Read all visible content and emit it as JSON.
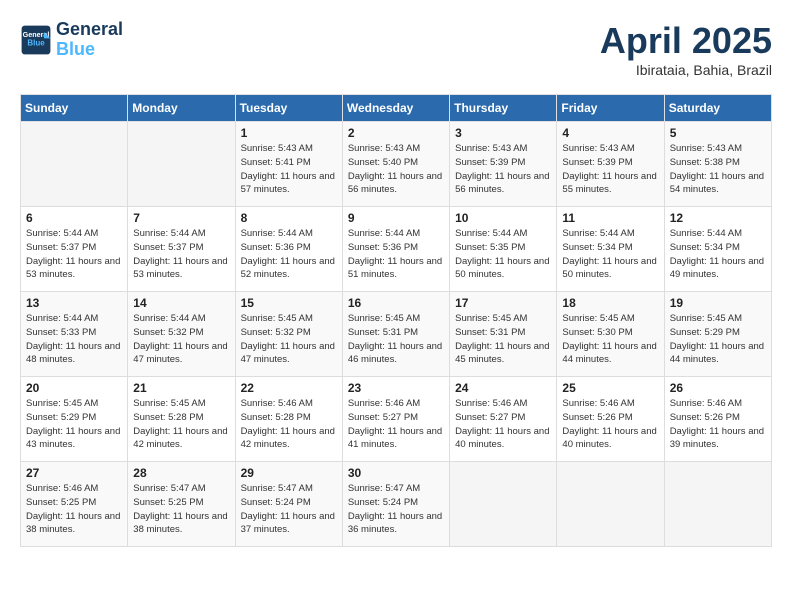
{
  "header": {
    "logo_line1": "General",
    "logo_line2": "Blue",
    "title": "April 2025",
    "subtitle": "Ibirataia, Bahia, Brazil"
  },
  "weekdays": [
    "Sunday",
    "Monday",
    "Tuesday",
    "Wednesday",
    "Thursday",
    "Friday",
    "Saturday"
  ],
  "weeks": [
    [
      {
        "day": "",
        "sunrise": "",
        "sunset": "",
        "daylight": ""
      },
      {
        "day": "",
        "sunrise": "",
        "sunset": "",
        "daylight": ""
      },
      {
        "day": "1",
        "sunrise": "Sunrise: 5:43 AM",
        "sunset": "Sunset: 5:41 PM",
        "daylight": "Daylight: 11 hours and 57 minutes."
      },
      {
        "day": "2",
        "sunrise": "Sunrise: 5:43 AM",
        "sunset": "Sunset: 5:40 PM",
        "daylight": "Daylight: 11 hours and 56 minutes."
      },
      {
        "day": "3",
        "sunrise": "Sunrise: 5:43 AM",
        "sunset": "Sunset: 5:39 PM",
        "daylight": "Daylight: 11 hours and 56 minutes."
      },
      {
        "day": "4",
        "sunrise": "Sunrise: 5:43 AM",
        "sunset": "Sunset: 5:39 PM",
        "daylight": "Daylight: 11 hours and 55 minutes."
      },
      {
        "day": "5",
        "sunrise": "Sunrise: 5:43 AM",
        "sunset": "Sunset: 5:38 PM",
        "daylight": "Daylight: 11 hours and 54 minutes."
      }
    ],
    [
      {
        "day": "6",
        "sunrise": "Sunrise: 5:44 AM",
        "sunset": "Sunset: 5:37 PM",
        "daylight": "Daylight: 11 hours and 53 minutes."
      },
      {
        "day": "7",
        "sunrise": "Sunrise: 5:44 AM",
        "sunset": "Sunset: 5:37 PM",
        "daylight": "Daylight: 11 hours and 53 minutes."
      },
      {
        "day": "8",
        "sunrise": "Sunrise: 5:44 AM",
        "sunset": "Sunset: 5:36 PM",
        "daylight": "Daylight: 11 hours and 52 minutes."
      },
      {
        "day": "9",
        "sunrise": "Sunrise: 5:44 AM",
        "sunset": "Sunset: 5:36 PM",
        "daylight": "Daylight: 11 hours and 51 minutes."
      },
      {
        "day": "10",
        "sunrise": "Sunrise: 5:44 AM",
        "sunset": "Sunset: 5:35 PM",
        "daylight": "Daylight: 11 hours and 50 minutes."
      },
      {
        "day": "11",
        "sunrise": "Sunrise: 5:44 AM",
        "sunset": "Sunset: 5:34 PM",
        "daylight": "Daylight: 11 hours and 50 minutes."
      },
      {
        "day": "12",
        "sunrise": "Sunrise: 5:44 AM",
        "sunset": "Sunset: 5:34 PM",
        "daylight": "Daylight: 11 hours and 49 minutes."
      }
    ],
    [
      {
        "day": "13",
        "sunrise": "Sunrise: 5:44 AM",
        "sunset": "Sunset: 5:33 PM",
        "daylight": "Daylight: 11 hours and 48 minutes."
      },
      {
        "day": "14",
        "sunrise": "Sunrise: 5:44 AM",
        "sunset": "Sunset: 5:32 PM",
        "daylight": "Daylight: 11 hours and 47 minutes."
      },
      {
        "day": "15",
        "sunrise": "Sunrise: 5:45 AM",
        "sunset": "Sunset: 5:32 PM",
        "daylight": "Daylight: 11 hours and 47 minutes."
      },
      {
        "day": "16",
        "sunrise": "Sunrise: 5:45 AM",
        "sunset": "Sunset: 5:31 PM",
        "daylight": "Daylight: 11 hours and 46 minutes."
      },
      {
        "day": "17",
        "sunrise": "Sunrise: 5:45 AM",
        "sunset": "Sunset: 5:31 PM",
        "daylight": "Daylight: 11 hours and 45 minutes."
      },
      {
        "day": "18",
        "sunrise": "Sunrise: 5:45 AM",
        "sunset": "Sunset: 5:30 PM",
        "daylight": "Daylight: 11 hours and 44 minutes."
      },
      {
        "day": "19",
        "sunrise": "Sunrise: 5:45 AM",
        "sunset": "Sunset: 5:29 PM",
        "daylight": "Daylight: 11 hours and 44 minutes."
      }
    ],
    [
      {
        "day": "20",
        "sunrise": "Sunrise: 5:45 AM",
        "sunset": "Sunset: 5:29 PM",
        "daylight": "Daylight: 11 hours and 43 minutes."
      },
      {
        "day": "21",
        "sunrise": "Sunrise: 5:45 AM",
        "sunset": "Sunset: 5:28 PM",
        "daylight": "Daylight: 11 hours and 42 minutes."
      },
      {
        "day": "22",
        "sunrise": "Sunrise: 5:46 AM",
        "sunset": "Sunset: 5:28 PM",
        "daylight": "Daylight: 11 hours and 42 minutes."
      },
      {
        "day": "23",
        "sunrise": "Sunrise: 5:46 AM",
        "sunset": "Sunset: 5:27 PM",
        "daylight": "Daylight: 11 hours and 41 minutes."
      },
      {
        "day": "24",
        "sunrise": "Sunrise: 5:46 AM",
        "sunset": "Sunset: 5:27 PM",
        "daylight": "Daylight: 11 hours and 40 minutes."
      },
      {
        "day": "25",
        "sunrise": "Sunrise: 5:46 AM",
        "sunset": "Sunset: 5:26 PM",
        "daylight": "Daylight: 11 hours and 40 minutes."
      },
      {
        "day": "26",
        "sunrise": "Sunrise: 5:46 AM",
        "sunset": "Sunset: 5:26 PM",
        "daylight": "Daylight: 11 hours and 39 minutes."
      }
    ],
    [
      {
        "day": "27",
        "sunrise": "Sunrise: 5:46 AM",
        "sunset": "Sunset: 5:25 PM",
        "daylight": "Daylight: 11 hours and 38 minutes."
      },
      {
        "day": "28",
        "sunrise": "Sunrise: 5:47 AM",
        "sunset": "Sunset: 5:25 PM",
        "daylight": "Daylight: 11 hours and 38 minutes."
      },
      {
        "day": "29",
        "sunrise": "Sunrise: 5:47 AM",
        "sunset": "Sunset: 5:24 PM",
        "daylight": "Daylight: 11 hours and 37 minutes."
      },
      {
        "day": "30",
        "sunrise": "Sunrise: 5:47 AM",
        "sunset": "Sunset: 5:24 PM",
        "daylight": "Daylight: 11 hours and 36 minutes."
      },
      {
        "day": "",
        "sunrise": "",
        "sunset": "",
        "daylight": ""
      },
      {
        "day": "",
        "sunrise": "",
        "sunset": "",
        "daylight": ""
      },
      {
        "day": "",
        "sunrise": "",
        "sunset": "",
        "daylight": ""
      }
    ]
  ]
}
